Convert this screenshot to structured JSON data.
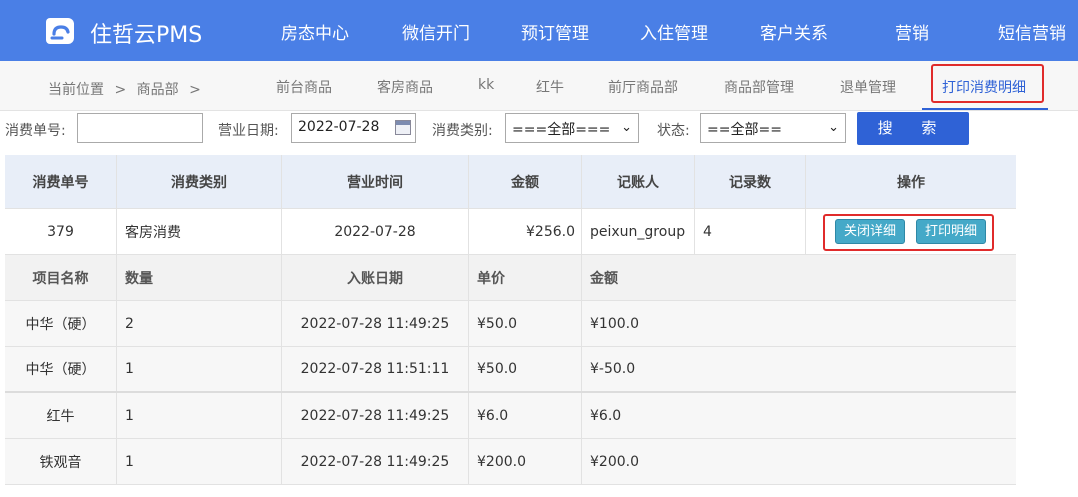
{
  "brand": {
    "name": "住哲云PMS"
  },
  "nav": [
    "房态中心",
    "微信开门",
    "预订管理",
    "入住管理",
    "客户关系",
    "营销",
    "短信营销"
  ],
  "breadcrumb": {
    "label": "当前位置",
    "sep1": ">",
    "dept": "商品部",
    "sep2": ">"
  },
  "subtabs": [
    "前台商品",
    "客房商品",
    "kk",
    "红牛",
    "前厅商品部",
    "商品部管理",
    "退单管理",
    "打印消费明细"
  ],
  "active_subtab": "打印消费明细",
  "filters": {
    "order_no_label": "消费单号:",
    "order_no_value": "",
    "date_label": "营业日期:",
    "date_value": "2022-07-28",
    "category_label": "消费类别:",
    "category_value": "===全部===",
    "status_label": "状态:",
    "status_value": "==全部==",
    "search_label": "搜 索"
  },
  "table": {
    "headers": [
      "消费单号",
      "消费类别",
      "营业时间",
      "金额",
      "记账人",
      "记录数",
      "操作"
    ],
    "order": {
      "no": "379",
      "category": "客房消费",
      "date": "2022-07-28",
      "amount": "¥256.0",
      "clerk": "peixun_group",
      "count": "4"
    },
    "actions": {
      "close_detail": "关闭详细",
      "print_detail": "打印明细"
    },
    "detail_headers": [
      "项目名称",
      "数量",
      "入账日期",
      "单价",
      "金额"
    ],
    "detail_rows": [
      {
        "name": "中华（硬）",
        "qty": "2",
        "date": "2022-07-28 11:49:25",
        "price": "¥50.0",
        "amount": "¥100.0"
      },
      {
        "name": "中华（硬）",
        "qty": "1",
        "date": "2022-07-28 11:51:11",
        "price": "¥50.0",
        "amount": "¥-50.0"
      },
      {
        "name": "红牛",
        "qty": "1",
        "date": "2022-07-28 11:49:25",
        "price": "¥6.0",
        "amount": "¥6.0"
      },
      {
        "name": "铁观音",
        "qty": "1",
        "date": "2022-07-28 11:49:25",
        "price": "¥200.0",
        "amount": "¥200.0"
      }
    ]
  },
  "colors": {
    "primary": "#4a7fe6",
    "button": "#2f62d6",
    "highlight": "#e02b2b",
    "action_button": "#45a9c8"
  }
}
